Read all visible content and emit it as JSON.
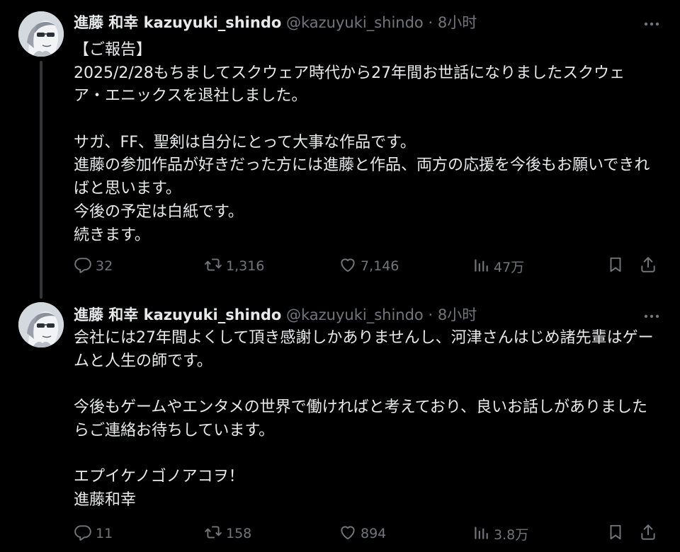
{
  "colors": {
    "background": "#000000",
    "text_primary": "#e7e9ea",
    "text_secondary": "#71767b",
    "thread_line": "#333639"
  },
  "tweets": [
    {
      "author": {
        "display_name": "進藤 和幸 kazuyuki_shindo",
        "handle": "@kazuyuki_shindo",
        "separator": "·",
        "time": "8小时"
      },
      "lines": [
        "【ご報告】",
        "2025/2/28もちましてスクウェア時代から27年間お世話になりましたスクウェ",
        "ア・エニックスを退社しました。",
        "",
        "サガ、FF、聖剣は自分にとって大事な作品です。",
        "進藤の参加作品が好きだった方には進藤と作品、両方の応援を今後もお願いできれ",
        "ばと思います。",
        "今後の予定は白紙です。",
        "続きます。"
      ],
      "stats": {
        "replies": "32",
        "retweets": "1,316",
        "likes": "7,146",
        "views": "47万"
      },
      "icons": [
        "reply-icon",
        "retweet-icon",
        "like-icon",
        "views-icon",
        "bookmark-icon",
        "share-icon",
        "more-icon"
      ]
    },
    {
      "author": {
        "display_name": "進藤 和幸 kazuyuki_shindo",
        "handle": "@kazuyuki_shindo",
        "separator": "·",
        "time": "8小时"
      },
      "lines": [
        "会社には27年間よくして頂き感謝しかありませんし、河津さんはじめ諸先輩はゲー",
        "ムと人生の師です。",
        "",
        "今後もゲームやエンタメの世界で働ければと考えており、良いお話しがありました",
        "らご連絡お待ちしています。",
        "",
        "エプイケノゴノアコヲ！",
        "進藤和幸"
      ],
      "stats": {
        "replies": "11",
        "retweets": "158",
        "likes": "894",
        "views": "3.8万"
      },
      "icons": [
        "reply-icon",
        "retweet-icon",
        "like-icon",
        "views-icon",
        "bookmark-icon",
        "share-icon",
        "more-icon"
      ]
    }
  ]
}
